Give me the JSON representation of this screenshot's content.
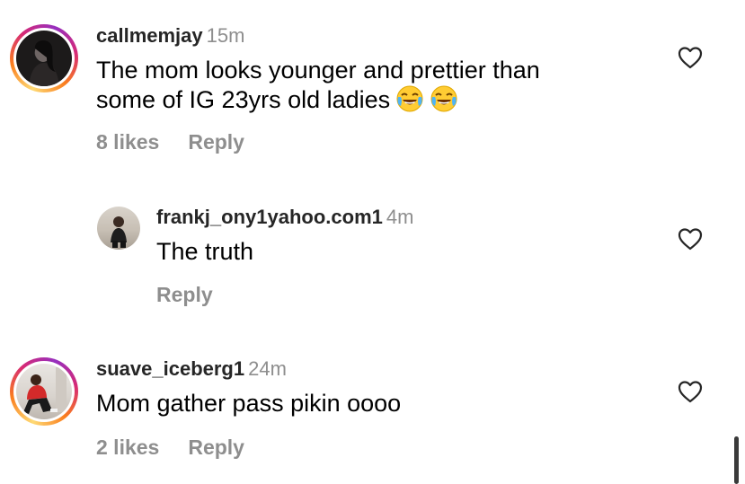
{
  "comments": [
    {
      "username": "callmemjay",
      "time": "15m",
      "text_line1": "The mom looks younger and prettier than",
      "text_line2": "some of IG 23yrs old ladies",
      "emojis": [
        "face-with-tears-of-joy",
        "face-with-tears-of-joy"
      ],
      "likes": "8 likes",
      "reply": "Reply"
    },
    {
      "username": "frankj_ony1yahoo.com1",
      "time": "4m",
      "text": "The truth",
      "reply": "Reply"
    },
    {
      "username": "suave_iceberg1",
      "time": "24m",
      "text": "Mom gather pass pikin oooo",
      "likes": "2 likes",
      "reply": "Reply"
    }
  ],
  "colors": {
    "secondary_text": "#8e8e8e",
    "username": "#262626",
    "heart_outline": "#262626",
    "scrollbar": "#3a3a3a"
  }
}
